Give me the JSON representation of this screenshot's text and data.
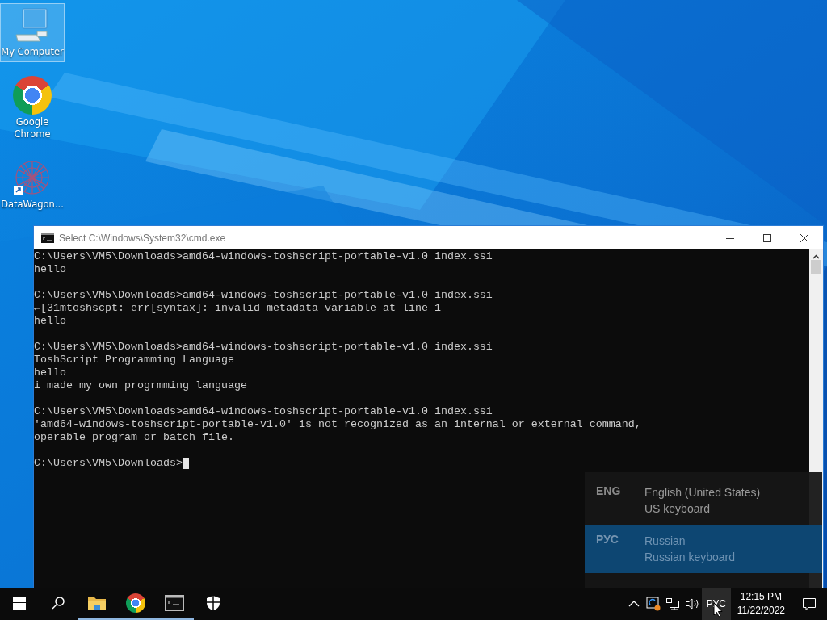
{
  "desktop_icons": [
    {
      "kind": "computer",
      "label": "My Computer",
      "selected": true
    },
    {
      "kind": "chrome",
      "label": "Google Chrome",
      "selected": false
    },
    {
      "kind": "network",
      "label": "DataWagon...",
      "selected": false
    }
  ],
  "window": {
    "title": "Select C:\\Windows\\System32\\cmd.exe",
    "console": {
      "blocks": [
        [
          "C:\\Users\\VM5\\Downloads>amd64-windows-toshscript-portable-v1.0 index.ssi",
          "hello"
        ],
        [
          "C:\\Users\\VM5\\Downloads>amd64-windows-toshscript-portable-v1.0 index.ssi",
          "←[31mtoshscpt: err[syntax]: invalid metadata variable at line 1",
          "hello"
        ],
        [
          "C:\\Users\\VM5\\Downloads>amd64-windows-toshscript-portable-v1.0 index.ssi",
          "ToshScript Programming Language",
          "hello",
          "i made my own progrmming language"
        ],
        [
          "C:\\Users\\VM5\\Downloads>amd64-windows-toshscript-portable-v1.0 index.ssi",
          "'amd64-windows-toshscript-portable-v1.0' is not recognized as an internal or external command,",
          "operable program or batch file."
        ]
      ],
      "prompt": "C:\\Users\\VM5\\Downloads>"
    }
  },
  "language_flyout": [
    {
      "code": "ENG",
      "name": "English (United States)",
      "layout": "US keyboard",
      "selected": false
    },
    {
      "code": "РУС",
      "name": "Russian",
      "layout": "Russian keyboard",
      "selected": true
    }
  ],
  "taskbar": {
    "apps": [
      {
        "kind": "start",
        "running": false
      },
      {
        "kind": "search",
        "running": false
      },
      {
        "kind": "explorer",
        "running": true
      },
      {
        "kind": "chrome",
        "running": true
      },
      {
        "kind": "terminal",
        "running": true
      },
      {
        "kind": "security",
        "running": false
      }
    ],
    "language": "РУС",
    "time": "12:15 PM",
    "date": "11/22/2022"
  }
}
